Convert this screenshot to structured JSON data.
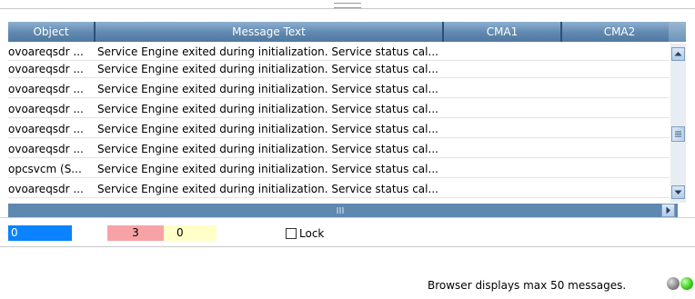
{
  "columns": {
    "object": "Object",
    "message": "Message Text",
    "cma1": "CMA1",
    "cma2": "CMA2"
  },
  "rows": [
    {
      "object": "ovoareqsdr ...",
      "message": "Service Engine exited during initialization. Service status cal...",
      "cma1": "",
      "cma2": ""
    },
    {
      "object": "ovoareqsdr ...",
      "message": "Service Engine exited during initialization. Service status cal...",
      "cma1": "",
      "cma2": ""
    },
    {
      "object": "ovoareqsdr ...",
      "message": "Service Engine exited during initialization. Service status cal...",
      "cma1": "",
      "cma2": ""
    },
    {
      "object": "ovoareqsdr ...",
      "message": "Service Engine exited during initialization. Service status cal...",
      "cma1": "",
      "cma2": ""
    },
    {
      "object": "ovoareqsdr ...",
      "message": "Service Engine exited during initialization. Service status cal...",
      "cma1": "",
      "cma2": ""
    },
    {
      "object": "ovoareqsdr ...",
      "message": "Service Engine exited during initialization. Service status cal...",
      "cma1": "",
      "cma2": ""
    },
    {
      "object": "opcsvcm (S...",
      "message": "Service Engine exited during initialization. Service status cal...",
      "cma1": "",
      "cma2": ""
    },
    {
      "object": "ovoareqsdr ...",
      "message": "Service Engine exited during initialization. Service status cal...",
      "cma1": "",
      "cma2": ""
    }
  ],
  "counters": {
    "blue": "0",
    "red": "3",
    "yellow": "0"
  },
  "lock": {
    "label": "Lock",
    "checked": false
  },
  "status": {
    "text": "Browser displays max 50 messages."
  },
  "colors": {
    "header": "#5f88b0",
    "counter_blue": "#0b82ff",
    "counter_red": "#f7a3a6",
    "counter_yellow": "#ffffc7",
    "led_green": "#3fcf1c",
    "led_gray": "#8a8a8a"
  },
  "icons": {
    "scroll_up": "arrow-up-icon",
    "scroll_down": "arrow-down-icon",
    "scroll_right": "arrow-right-icon",
    "thumb_grip": "grip-icon"
  }
}
